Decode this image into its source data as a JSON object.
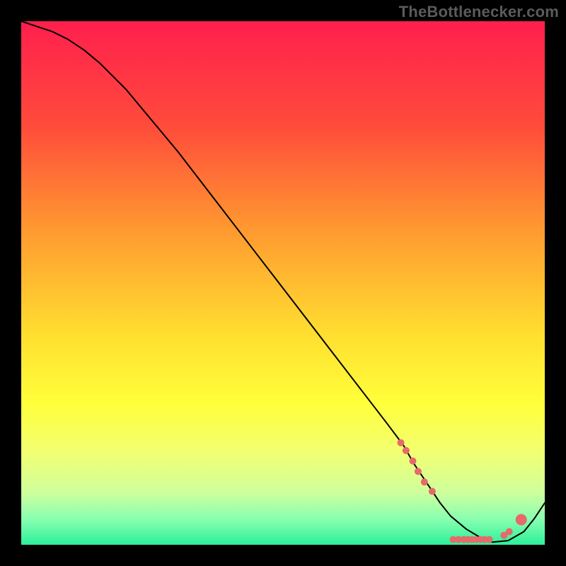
{
  "attribution": "TheBottlenecker.com",
  "chart_data": {
    "type": "line",
    "title": "",
    "xlabel": "",
    "ylabel": "",
    "xlim": [
      0,
      100
    ],
    "ylim": [
      0,
      100
    ],
    "grid": false,
    "background": {
      "kind": "vertical-gradient",
      "stops": [
        {
          "pos": 0.0,
          "color": "#ff1f4d"
        },
        {
          "pos": 0.2,
          "color": "#ff4b3b"
        },
        {
          "pos": 0.4,
          "color": "#ff9a30"
        },
        {
          "pos": 0.6,
          "color": "#ffdf30"
        },
        {
          "pos": 0.73,
          "color": "#ffff3a"
        },
        {
          "pos": 0.82,
          "color": "#f3ff70"
        },
        {
          "pos": 0.9,
          "color": "#cfff9c"
        },
        {
          "pos": 0.95,
          "color": "#8affb0"
        },
        {
          "pos": 1.0,
          "color": "#2cf09a"
        }
      ]
    },
    "series": [
      {
        "name": "bottleneck-curve",
        "color": "#000000",
        "width": 2,
        "x": [
          0,
          3,
          6,
          9,
          12,
          15,
          20,
          25,
          30,
          35,
          40,
          45,
          50,
          55,
          60,
          65,
          70,
          73,
          75,
          78,
          80,
          82,
          85,
          88,
          90,
          93,
          96,
          98,
          100
        ],
        "y": [
          100,
          99,
          98,
          96.5,
          94.5,
          92,
          87,
          81,
          75,
          68.5,
          62,
          55.5,
          49,
          42.5,
          36,
          29.5,
          23,
          19,
          15.5,
          11,
          8,
          5.5,
          3,
          1.2,
          0.5,
          0.8,
          2.5,
          5,
          8
        ]
      }
    ],
    "markers": {
      "name": "highlight-dots",
      "color": "#e66a6a",
      "radius_small": 5,
      "radius_large": 8,
      "points": [
        {
          "x": 72.5,
          "y": 19.5,
          "r": "small"
        },
        {
          "x": 73.5,
          "y": 18.0,
          "r": "small"
        },
        {
          "x": 74.8,
          "y": 16.0,
          "r": "small"
        },
        {
          "x": 75.8,
          "y": 14.0,
          "r": "small"
        },
        {
          "x": 77.0,
          "y": 12.0,
          "r": "small"
        },
        {
          "x": 78.5,
          "y": 10.2,
          "r": "small"
        },
        {
          "x": 82.5,
          "y": 1.0,
          "r": "small"
        },
        {
          "x": 83.5,
          "y": 1.0,
          "r": "small"
        },
        {
          "x": 84.5,
          "y": 1.0,
          "r": "small"
        },
        {
          "x": 85.3,
          "y": 1.0,
          "r": "small"
        },
        {
          "x": 86.1,
          "y": 1.0,
          "r": "small"
        },
        {
          "x": 86.9,
          "y": 1.0,
          "r": "small"
        },
        {
          "x": 87.7,
          "y": 1.0,
          "r": "small"
        },
        {
          "x": 88.5,
          "y": 1.0,
          "r": "small"
        },
        {
          "x": 89.4,
          "y": 1.0,
          "r": "small"
        },
        {
          "x": 92.2,
          "y": 1.8,
          "r": "small"
        },
        {
          "x": 93.2,
          "y": 2.5,
          "r": "small"
        },
        {
          "x": 95.5,
          "y": 4.8,
          "r": "large"
        }
      ]
    }
  }
}
